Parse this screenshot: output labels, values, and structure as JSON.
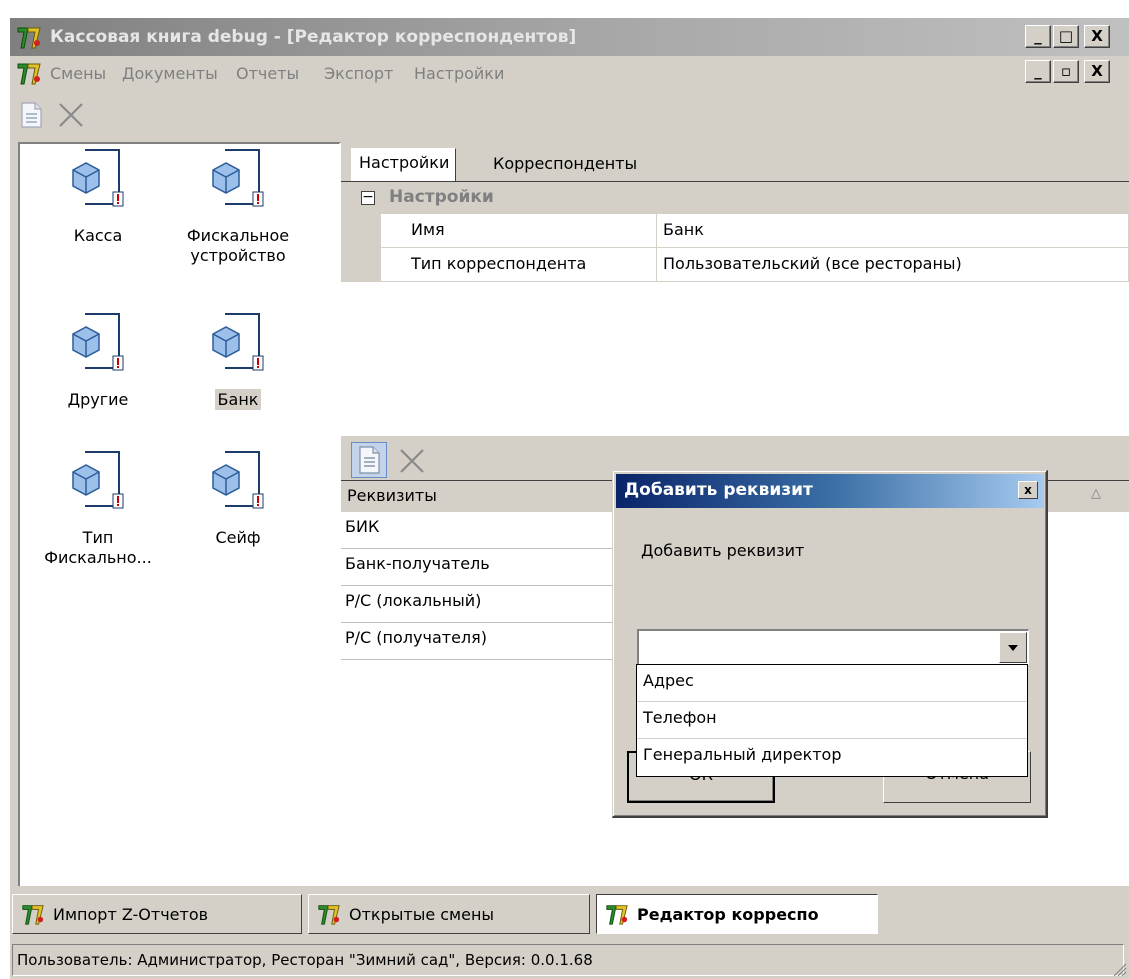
{
  "window": {
    "title": "Кассовая книга debug - [Редактор корреспондентов]",
    "controls": {
      "minimize": "_",
      "maximize": "□",
      "close": "X",
      "child_restore": "▫"
    }
  },
  "menu": {
    "items": [
      "Смены",
      "Документы",
      "Отчеты",
      "Экспорт",
      "Настройки"
    ]
  },
  "tiles": [
    {
      "label": "Касса",
      "icon": "document-cube-icon"
    },
    {
      "label": "Фискальное устройство",
      "icon": "document-cube-icon"
    },
    {
      "label": "Другие",
      "icon": "document-cube-icon"
    },
    {
      "label": "Банк",
      "icon": "document-cube-icon"
    },
    {
      "label": "Тип Фискально...",
      "icon": "document-cube-icon"
    },
    {
      "label": "Сейф",
      "icon": "document-cube-icon"
    }
  ],
  "tabs": [
    {
      "label": "Настройки",
      "active": true
    },
    {
      "label": "Корреспонденты",
      "active": false
    }
  ],
  "settings": {
    "section_title": "Настройки",
    "collapse_glyph": "−",
    "properties": [
      {
        "name": "Имя",
        "value": "Банк"
      },
      {
        "name": "Тип корреспондента",
        "value": "Пользовательский (все рестораны)"
      }
    ]
  },
  "requisites": {
    "column_header": "Реквизиты",
    "sort_glyph": "△",
    "rows": [
      "БИК",
      "Банк-получатель",
      "Р/С (локальный)",
      "Р/С (получателя)"
    ]
  },
  "dialog": {
    "title": "Добавить реквизит",
    "prompt": "Добавить реквизит",
    "combo_value": "",
    "options": [
      "Адрес",
      "Телефон",
      "Генеральный директор"
    ],
    "ok_label": "ОК",
    "cancel_label": "Отмена",
    "close_glyph": "x"
  },
  "taskbar": {
    "items": [
      {
        "label": "Импорт Z-Отчетов",
        "active": false
      },
      {
        "label": "Открытые смены",
        "active": false
      },
      {
        "label": "Редактор корреспо",
        "active": true
      }
    ]
  },
  "status": {
    "text": "Пользователь: Администратор, Ресторан \"Зимний сад\", Версия: 0.0.1.68"
  },
  "colors": {
    "face": "#d4d0c8",
    "dialog_title_start": "#0a246a",
    "dialog_title_end": "#a6caf0",
    "alert_red": "#cc0000",
    "cube_blue": "#7aa7d8"
  }
}
